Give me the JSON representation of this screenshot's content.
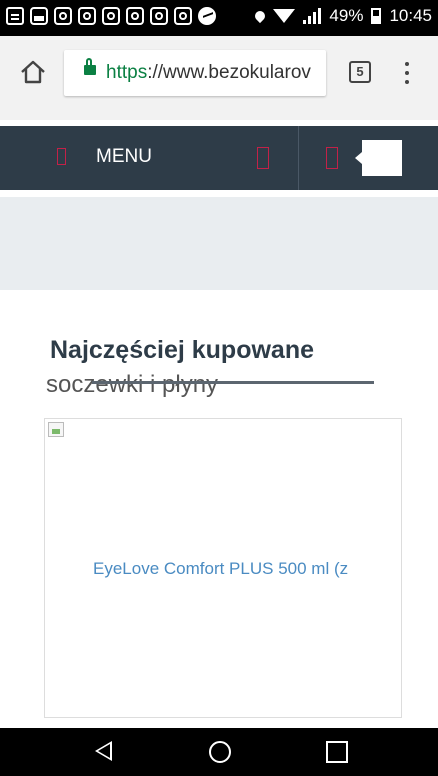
{
  "status_bar": {
    "battery": "49%",
    "time": "10:45"
  },
  "browser": {
    "url_scheme": "https",
    "url_rest": "://www.bezokularov",
    "tab_count": "5"
  },
  "site_nav": {
    "menu_label": "MENU"
  },
  "section": {
    "title": "Najczęściej kupowane",
    "subtitle": "soczewki i płyny"
  },
  "product_card": {
    "name": "EyeLove Comfort PLUS 500 ml (z"
  },
  "colors": {
    "nav_bg": "#2e3c48",
    "link": "#4a8bc2",
    "url_green": "#0b8043",
    "band_gray": "#e9edf0"
  }
}
